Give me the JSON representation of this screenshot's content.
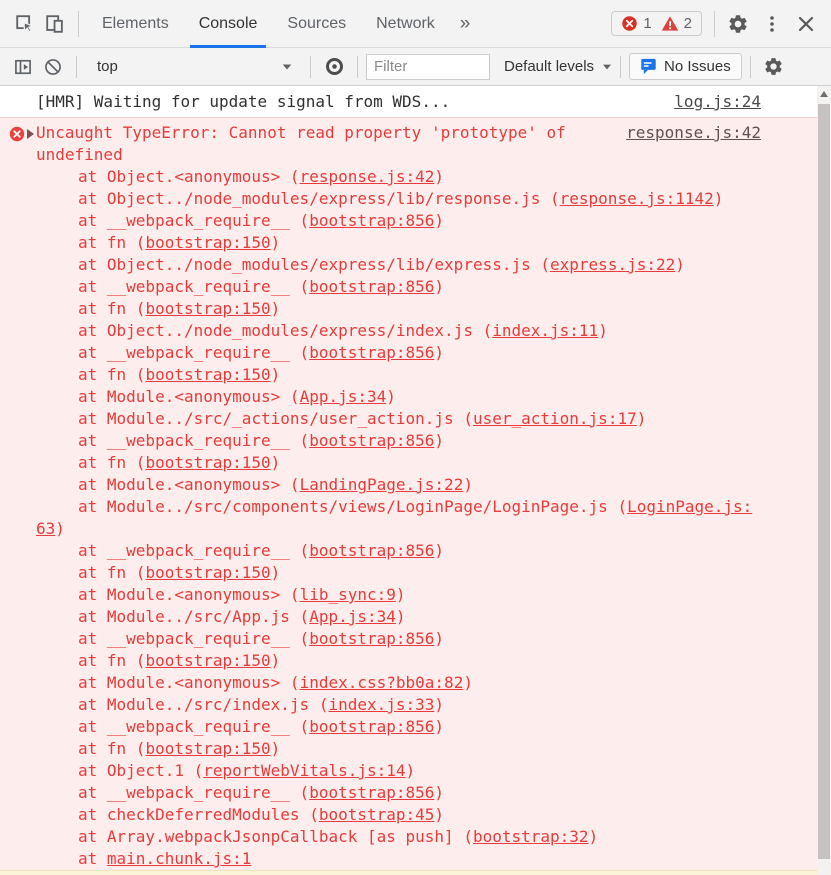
{
  "toolbar": {
    "tabs": [
      {
        "label": "Elements",
        "active": false
      },
      {
        "label": "Console",
        "active": true
      },
      {
        "label": "Sources",
        "active": false
      },
      {
        "label": "Network",
        "active": false
      }
    ],
    "more_tabs_glyph": "»",
    "error_count": "1",
    "warning_count": "2"
  },
  "console_toolbar": {
    "context_selector": "top",
    "filter_placeholder": "Filter",
    "levels_label": "Default levels",
    "issues_label": "No Issues"
  },
  "console": {
    "log_message": {
      "text": "[HMR] Waiting for update signal from WDS...",
      "link": "log.js:24"
    },
    "error": {
      "message_line1": "Uncaught TypeError: Cannot read property 'prototype' of",
      "message_line2": "undefined",
      "source_link": "response.js:42",
      "stack": [
        {
          "pre": "at Object.<anonymous> (",
          "link": "response.js:42",
          "post": ")"
        },
        {
          "pre": "at Object../node_modules/express/lib/response.js (",
          "link": "response.js:1142",
          "post": ")"
        },
        {
          "pre": "at __webpack_require__ (",
          "link": "bootstrap:856",
          "post": ")"
        },
        {
          "pre": "at fn (",
          "link": "bootstrap:150",
          "post": ")"
        },
        {
          "pre": "at Object../node_modules/express/lib/express.js (",
          "link": "express.js:22",
          "post": ")"
        },
        {
          "pre": "at __webpack_require__ (",
          "link": "bootstrap:856",
          "post": ")"
        },
        {
          "pre": "at fn (",
          "link": "bootstrap:150",
          "post": ")"
        },
        {
          "pre": "at Object../node_modules/express/index.js (",
          "link": "index.js:11",
          "post": ")"
        },
        {
          "pre": "at __webpack_require__ (",
          "link": "bootstrap:856",
          "post": ")"
        },
        {
          "pre": "at fn (",
          "link": "bootstrap:150",
          "post": ")"
        },
        {
          "pre": "at Module.<anonymous> (",
          "link": "App.js:34",
          "post": ")"
        },
        {
          "pre": "at Module../src/_actions/user_action.js (",
          "link": "user_action.js:17",
          "post": ")"
        },
        {
          "pre": "at __webpack_require__ (",
          "link": "bootstrap:856",
          "post": ")"
        },
        {
          "pre": "at fn (",
          "link": "bootstrap:150",
          "post": ")"
        },
        {
          "pre": "at Module.<anonymous> (",
          "link": "LandingPage.js:22",
          "post": ")"
        },
        {
          "pre": "at Module../src/components/views/LoginPage/LoginPage.js (",
          "link": "LoginPage.js:",
          "post": ""
        },
        {
          "pre": "",
          "link": "63",
          "post": ")",
          "no_indent": true
        },
        {
          "pre": "at __webpack_require__ (",
          "link": "bootstrap:856",
          "post": ")"
        },
        {
          "pre": "at fn (",
          "link": "bootstrap:150",
          "post": ")"
        },
        {
          "pre": "at Module.<anonymous> (",
          "link": "lib_sync:9",
          "post": ")"
        },
        {
          "pre": "at Module../src/App.js (",
          "link": "App.js:34",
          "post": ")"
        },
        {
          "pre": "at __webpack_require__ (",
          "link": "bootstrap:856",
          "post": ")"
        },
        {
          "pre": "at fn (",
          "link": "bootstrap:150",
          "post": ")"
        },
        {
          "pre": "at Module.<anonymous> (",
          "link": "index.css?bb0a:82",
          "post": ")"
        },
        {
          "pre": "at Module../src/index.js (",
          "link": "index.js:33",
          "post": ")"
        },
        {
          "pre": "at __webpack_require__ (",
          "link": "bootstrap:856",
          "post": ")"
        },
        {
          "pre": "at fn (",
          "link": "bootstrap:150",
          "post": ")"
        },
        {
          "pre": "at Object.1 (",
          "link": "reportWebVitals.js:14",
          "post": ")"
        },
        {
          "pre": "at __webpack_require__ (",
          "link": "bootstrap:856",
          "post": ")"
        },
        {
          "pre": "at checkDeferredModules (",
          "link": "bootstrap:45",
          "post": ")"
        },
        {
          "pre": "at Array.webpackJsonpCallback [as push] (",
          "link": "bootstrap:32",
          "post": ")"
        },
        {
          "pre": "at ",
          "link": "main.chunk.js:1",
          "post": ""
        }
      ]
    }
  },
  "colors": {
    "accent": "#1a73e8",
    "error_red": "#e83b3b",
    "error_badge": "#d93025",
    "warning_badge": "#d9453e",
    "error_background": "#fdeeed",
    "warning_background": "#fbf4d9",
    "toolbar_background": "#f3f3f3",
    "icon_gray": "#5f6368"
  },
  "icons": {
    "inspect": "cursor-over-box",
    "device-toolbar": "phone-and-tablet",
    "error-badge": "red-circle-x",
    "warning-badge": "red-triangle-exclamation",
    "settings": "gear",
    "menu": "vertical-three-dots",
    "close": "x",
    "console-sidebar": "panel-with-play-triangle",
    "clear-console": "circle-with-slash",
    "live-expression": "eye",
    "issues": "blue-speech-bubble"
  }
}
